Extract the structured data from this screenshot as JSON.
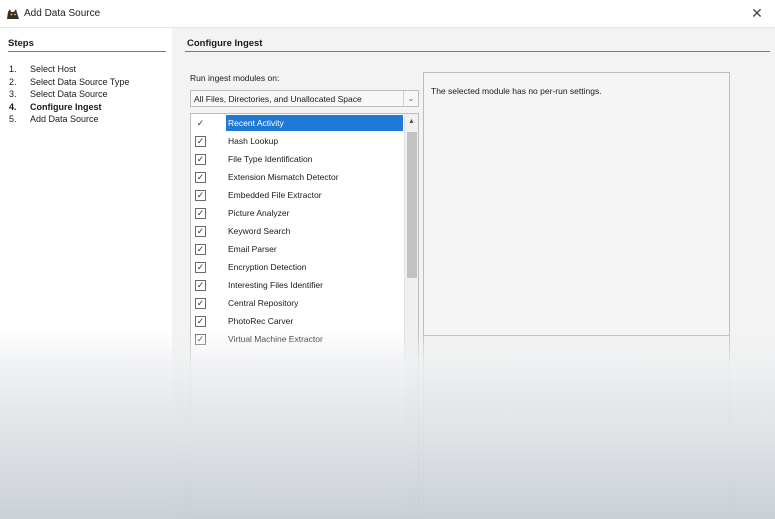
{
  "window": {
    "title": "Add Data Source",
    "close_glyph": "✕",
    "app_icon": "autopsy-dog-icon"
  },
  "steps": {
    "title": "Steps",
    "items": [
      {
        "num": "1.",
        "label": "Select Host",
        "active": false
      },
      {
        "num": "2.",
        "label": "Select Data Source Type",
        "active": false
      },
      {
        "num": "3.",
        "label": "Select Data Source",
        "active": false
      },
      {
        "num": "4.",
        "label": "Configure Ingest",
        "active": true
      },
      {
        "num": "5.",
        "label": "Add Data Source",
        "active": false
      }
    ]
  },
  "ingest": {
    "title": "Configure Ingest",
    "run_on_label": "Run ingest modules on:",
    "scope_value": "All Files, Directories, and Unallocated Space",
    "modules": [
      {
        "name": "Recent Activity",
        "checked": true,
        "selected": true
      },
      {
        "name": "Hash Lookup",
        "checked": true,
        "selected": false
      },
      {
        "name": "File Type Identification",
        "checked": true,
        "selected": false
      },
      {
        "name": "Extension Mismatch Detector",
        "checked": true,
        "selected": false
      },
      {
        "name": "Embedded File Extractor",
        "checked": true,
        "selected": false
      },
      {
        "name": "Picture Analyzer",
        "checked": true,
        "selected": false
      },
      {
        "name": "Keyword Search",
        "checked": true,
        "selected": false
      },
      {
        "name": "Email Parser",
        "checked": true,
        "selected": false
      },
      {
        "name": "Encryption Detection",
        "checked": true,
        "selected": false
      },
      {
        "name": "Interesting Files Identifier",
        "checked": true,
        "selected": false
      },
      {
        "name": "Central Repository",
        "checked": true,
        "selected": false
      },
      {
        "name": "PhotoRec Carver",
        "checked": true,
        "selected": false
      },
      {
        "name": "Virtual Machine Extractor",
        "checked": true,
        "selected": false
      }
    ],
    "settings_message": "The selected module has no per-run settings."
  },
  "colors": {
    "selection": "#1e7ad6"
  }
}
